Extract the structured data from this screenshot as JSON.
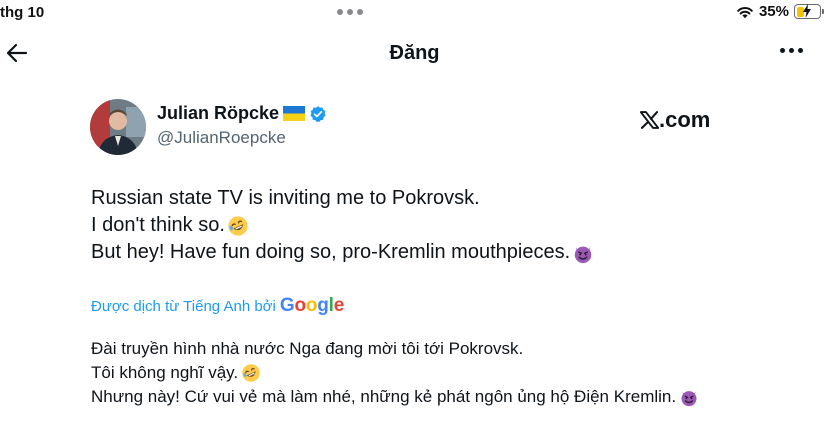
{
  "status_bar": {
    "time": "thg 10",
    "battery_percent": "35%",
    "battery_level": 0.35,
    "icons": [
      "multitask-dots-icon",
      "wifi-icon",
      "battery-charging-icon"
    ]
  },
  "nav": {
    "title": "Đăng",
    "icons": [
      "back-arrow-icon",
      "more-icon"
    ]
  },
  "tweet": {
    "author_name": "Julian Röpcke",
    "handle": "@JulianRoepcke",
    "source_label": ".com",
    "icons": [
      "ukraine-flag-icon",
      "verified-badge-icon",
      "x-logo-icon"
    ],
    "lines": [
      "Russian state TV is inviting me to Pokrovsk.",
      "I don't think so.",
      "But hey! Have fun doing so, pro-Kremlin mouthpieces."
    ],
    "emojis": [
      "rofl-emoji",
      "smiling-devil-emoji"
    ]
  },
  "translation": {
    "label": "Được dịch từ Tiếng Anh bởi",
    "provider": "Google",
    "provider_letters": [
      "G",
      "o",
      "o",
      "g",
      "l",
      "e"
    ],
    "provider_colors": [
      "#4285F4",
      "#EA4335",
      "#FBBC05",
      "#4285F4",
      "#34A853",
      "#EA4335"
    ],
    "lines": [
      "Đài truyền hình nhà nước Nga đang mời tôi tới Pokrovsk.",
      "Tôi không nghĩ vậy.",
      "Nhưng này! Cứ vui vẻ mà làm nhé, những kẻ phát ngôn ủng hộ Điện Kremlin."
    ]
  },
  "colors": {
    "link_blue": "#1d9bf0",
    "handle_gray": "#536471",
    "text": "#0f1419",
    "battery_yellow": "#f5c400"
  }
}
